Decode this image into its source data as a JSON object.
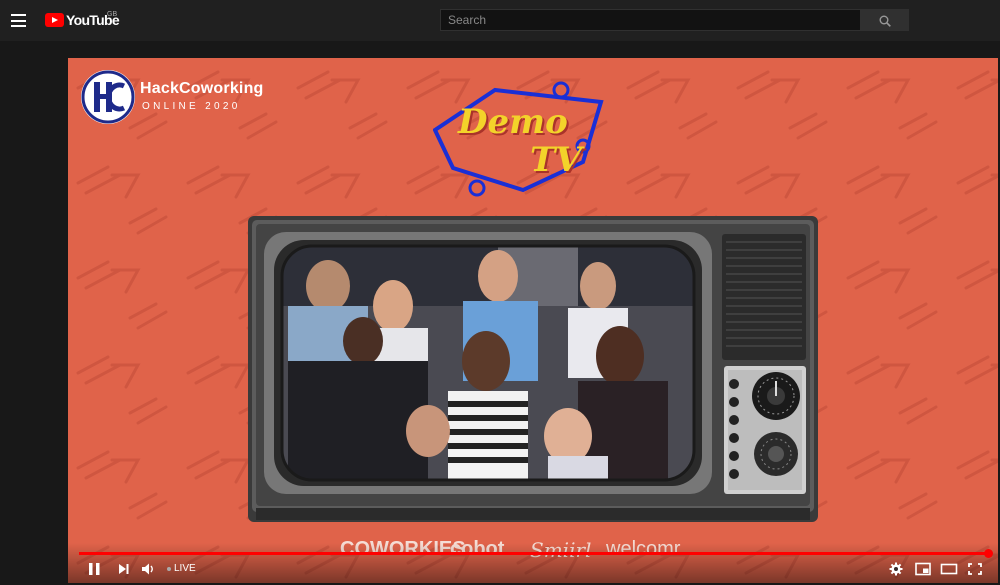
{
  "header": {
    "logo_text": "YouTube",
    "region": "GB",
    "search_placeholder": "Search"
  },
  "video": {
    "brand_name": "HackCoworking",
    "brand_sub": "ONLINE 2020",
    "brand_monogram": "HC",
    "demo_line1": "Demo",
    "demo_line2": "TV",
    "sponsors": [
      "COWORKIES",
      "cobot",
      "Smiirl",
      "welcomr"
    ]
  },
  "player": {
    "live_label": "LIVE",
    "progress": 1.0,
    "colors": {
      "accent": "#ff0000",
      "background": "#e0634a"
    }
  },
  "icons": [
    "menu-icon",
    "youtube-logo-icon",
    "search-icon",
    "pause-icon",
    "next-icon",
    "volume-icon",
    "settings-icon",
    "miniplayer-icon",
    "theater-icon",
    "fullscreen-icon"
  ]
}
